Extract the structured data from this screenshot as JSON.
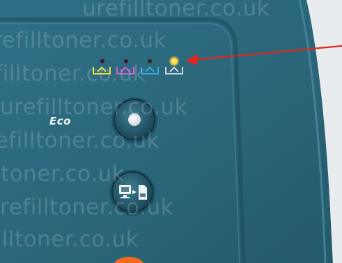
{
  "photo": {
    "subject": "Printer control panel with toner indicator lights",
    "eco_button_label": "Eco",
    "watermark_text": "urefilltoner.co.uk",
    "colors": {
      "panel": "#2c6b80",
      "panel_dark": "#1e4f61",
      "arrow": "#e0261f",
      "lit_led": "#ffd23a",
      "toner_yellow": "#e7e33a",
      "toner_magenta": "#e05ad0",
      "toner_cyan": "#3aa8e8",
      "toner_black": "#d0d6dc",
      "start_button_orange": "#f06a1f"
    },
    "indicators": [
      {
        "name": "yellow-toner",
        "lit": false
      },
      {
        "name": "magenta-toner",
        "lit": false
      },
      {
        "name": "cyan-toner",
        "lit": false
      },
      {
        "name": "black-toner",
        "lit": true
      }
    ]
  }
}
